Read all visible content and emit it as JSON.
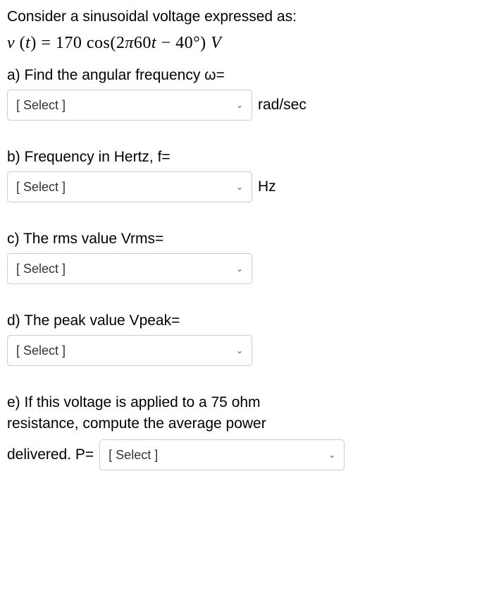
{
  "intro": "Consider a sinusoidal voltage expressed as:",
  "equation_html": "v (t) = 170 cos(2π60t − 40°) V",
  "select_placeholder": "[ Select ]",
  "questions": {
    "a": {
      "text": "a) Find the angular frequency  ω=",
      "unit": "rad/sec"
    },
    "b": {
      "text": "b) Frequency in Hertz, f=",
      "unit": "Hz"
    },
    "c": {
      "text": "c) The rms value Vrms=",
      "unit": ""
    },
    "d": {
      "text": "d) The peak value Vpeak=",
      "unit": ""
    },
    "e": {
      "line1": "e) If this voltage is applied to a 75 ohm",
      "line2": "resistance, compute the average power",
      "line3_prefix": "delivered. P=",
      "unit": ""
    }
  }
}
